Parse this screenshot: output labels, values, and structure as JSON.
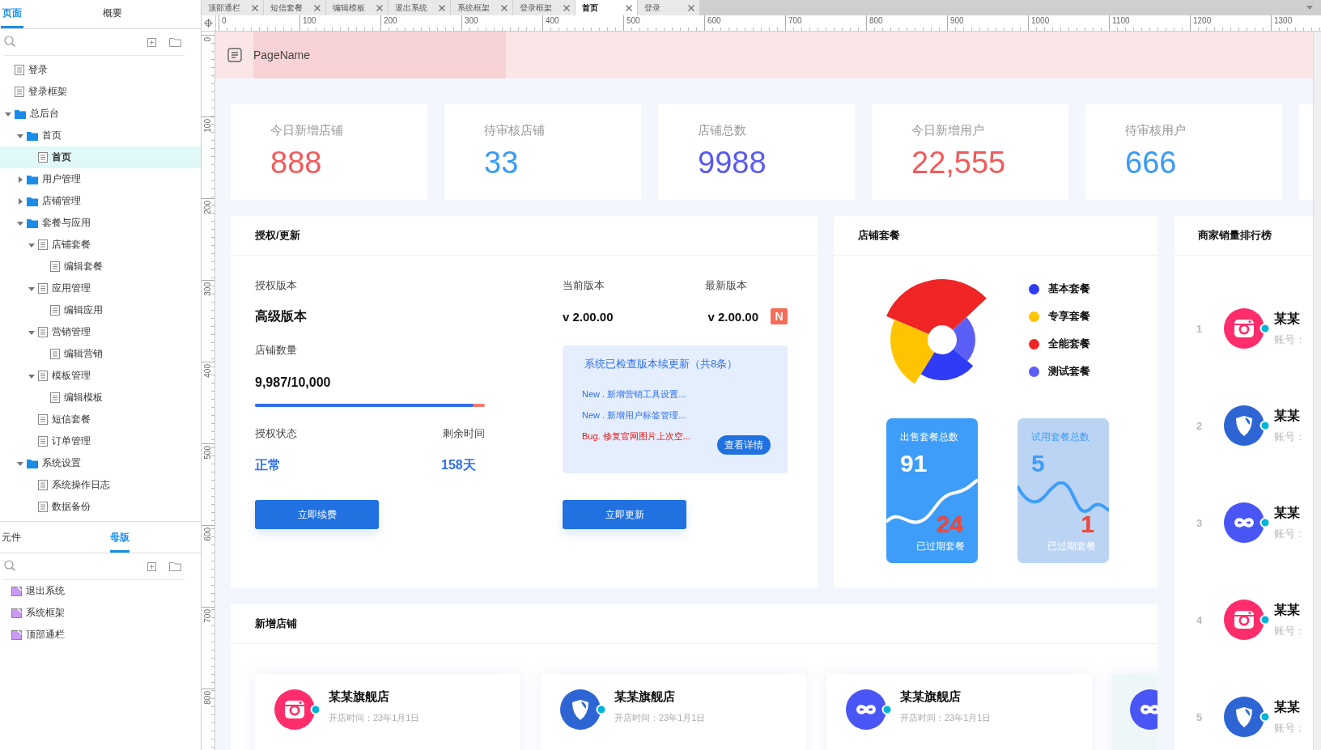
{
  "left_panel": {
    "top_tabs": [
      {
        "label": "页面",
        "selected": true
      },
      {
        "label": "概要",
        "selected": false
      }
    ],
    "page_tree": [
      {
        "label": "登录",
        "kind": "page",
        "selected": false
      },
      {
        "label": "登录框架",
        "kind": "page",
        "selected": false
      },
      {
        "label": "总后台",
        "kind": "folder",
        "expanded": true,
        "selected": false,
        "children": [
          {
            "label": "首页",
            "kind": "folder",
            "expanded": true,
            "selected": false,
            "children": [
              {
                "label": "首页",
                "kind": "page",
                "selected": true
              }
            ]
          },
          {
            "label": "用户管理",
            "kind": "folder",
            "expanded": false,
            "selected": false
          },
          {
            "label": "店铺管理",
            "kind": "folder",
            "expanded": false,
            "selected": false
          },
          {
            "label": "套餐与应用",
            "kind": "folder",
            "expanded": true,
            "selected": false,
            "children": [
              {
                "label": "店铺套餐",
                "kind": "page",
                "expanded": true,
                "selected": false,
                "children": [
                  {
                    "label": "编辑套餐",
                    "kind": "page",
                    "selected": false
                  }
                ]
              },
              {
                "label": "应用管理",
                "kind": "page",
                "expanded": true,
                "selected": false,
                "children": [
                  {
                    "label": "编辑应用",
                    "kind": "page",
                    "selected": false
                  }
                ]
              },
              {
                "label": "营销管理",
                "kind": "page",
                "expanded": true,
                "selected": false,
                "children": [
                  {
                    "label": "编辑营销",
                    "kind": "page",
                    "selected": false
                  }
                ]
              },
              {
                "label": "模板管理",
                "kind": "page",
                "expanded": true,
                "selected": false,
                "children": [
                  {
                    "label": "编辑模板",
                    "kind": "page",
                    "selected": false
                  }
                ]
              },
              {
                "label": "短信套餐",
                "kind": "page",
                "selected": false
              },
              {
                "label": "订单管理",
                "kind": "page",
                "selected": false
              }
            ]
          },
          {
            "label": "系统设置",
            "kind": "folder",
            "expanded": true,
            "selected": false,
            "children": [
              {
                "label": "系统操作日志",
                "kind": "page",
                "selected": false
              },
              {
                "label": "数据备份",
                "kind": "page",
                "selected": false
              }
            ]
          }
        ]
      }
    ],
    "bottom_tabs": [
      {
        "label": "元件",
        "selected": false
      },
      {
        "label": "母版",
        "selected": true
      }
    ],
    "masters": [
      "退出系统",
      "系统框架",
      "顶部通栏"
    ]
  },
  "document_tabs": [
    {
      "label": "顶部通栏",
      "selected": false
    },
    {
      "label": "短信套餐",
      "selected": false
    },
    {
      "label": "编辑模板",
      "selected": false
    },
    {
      "label": "退出系统",
      "selected": false
    },
    {
      "label": "系统框架",
      "selected": false
    },
    {
      "label": "登录框架",
      "selected": false
    },
    {
      "label": "首页",
      "selected": true
    },
    {
      "label": "登录",
      "selected": false
    }
  ],
  "rulers": {
    "horizontal": [
      "0",
      "100",
      "200",
      "300",
      "400",
      "500",
      "600",
      "700",
      "800",
      "900",
      "1000",
      "1100",
      "1200",
      "1300"
    ],
    "vertical": [
      "0",
      "100",
      "200",
      "300",
      "400",
      "500",
      "600",
      "700",
      "800"
    ]
  },
  "page": {
    "header": {
      "title": "PageName"
    },
    "stats": [
      {
        "label": "今日新增店铺",
        "value": "888",
        "color": "#f25b5b"
      },
      {
        "label": "待审核店铺",
        "value": "33",
        "color": "#3a9bf5"
      },
      {
        "label": "店铺总数",
        "value": "9988",
        "color": "#5a5af0"
      },
      {
        "label": "今日新增用户",
        "value": "22,555",
        "color": "#f25b5b"
      },
      {
        "label": "待审核用户",
        "value": "666",
        "color": "#3a9bf5"
      }
    ],
    "license_panel": {
      "title": "授权/更新",
      "version_label": "授权版本",
      "version": "高级版本",
      "store_count_label": "店铺数量",
      "store_count": "9,987/10,000",
      "level": 0.95,
      "status_label": "授权状态",
      "status": "正常",
      "remaining_label": "剩余时间",
      "remaining": "158天",
      "renew_button": "立即续费",
      "current_version_label": "当前版本",
      "current_version": "v 2.00.00",
      "latest_version_label": "最新版本",
      "latest_version": "v 2.00.00",
      "new_badge": "N",
      "update_box": {
        "title": "系统已检查版本续更新（共8条）",
        "items": [
          {
            "kind": "new",
            "text": "New . 新增营销工具设置..."
          },
          {
            "kind": "new",
            "text": "New . 新增用户标签管理..."
          },
          {
            "kind": "bug",
            "text": "Bug. 修复官网图片上次空..."
          }
        ],
        "details_button": "查看详情"
      },
      "update_button": "立即更新"
    },
    "package_panel": {
      "title": "店铺套餐",
      "legend": [
        {
          "label": "基本套餐",
          "color": "#2f3bf5"
        },
        {
          "label": "专享套餐",
          "color": "#ffc400"
        },
        {
          "label": "全能套餐",
          "color": "#f02525"
        },
        {
          "label": "测试套餐",
          "color": "#5b5ff5"
        }
      ],
      "tiles": [
        {
          "kind": "solid",
          "title": "出售套餐总数",
          "total": "91",
          "expired": "24",
          "expired_label": "已过期套餐"
        },
        {
          "kind": "light",
          "title": "试用套餐总数",
          "total": "5",
          "expired": "1",
          "expired_label": "已过期套餐"
        }
      ]
    },
    "new_stores_panel": {
      "title": "新增店铺",
      "stores": [
        {
          "kind": "camera",
          "name": "某某旗舰店",
          "opened": "开店时间：23年1月1日"
        },
        {
          "kind": "shield",
          "name": "某某旗舰店",
          "opened": "开店时间：23年1月1日"
        },
        {
          "kind": "infinity",
          "name": "某某旗舰店",
          "opened": "开店时间：23年1月1日"
        },
        {
          "kind": "infinity"
        }
      ]
    },
    "ranking_panel": {
      "title": "商家销量排行榜",
      "rows": [
        {
          "rank": "1",
          "kind": "camera",
          "name": "某某",
          "account": "账号："
        },
        {
          "rank": "2",
          "kind": "shield",
          "name": "某某",
          "account": "账号："
        },
        {
          "rank": "3",
          "kind": "infinity",
          "name": "某某",
          "account": "账号："
        },
        {
          "rank": "4",
          "kind": "camera",
          "name": "某某",
          "account": "账号："
        },
        {
          "rank": "5",
          "kind": "shield",
          "name": "某某",
          "account": "账号："
        }
      ]
    }
  }
}
